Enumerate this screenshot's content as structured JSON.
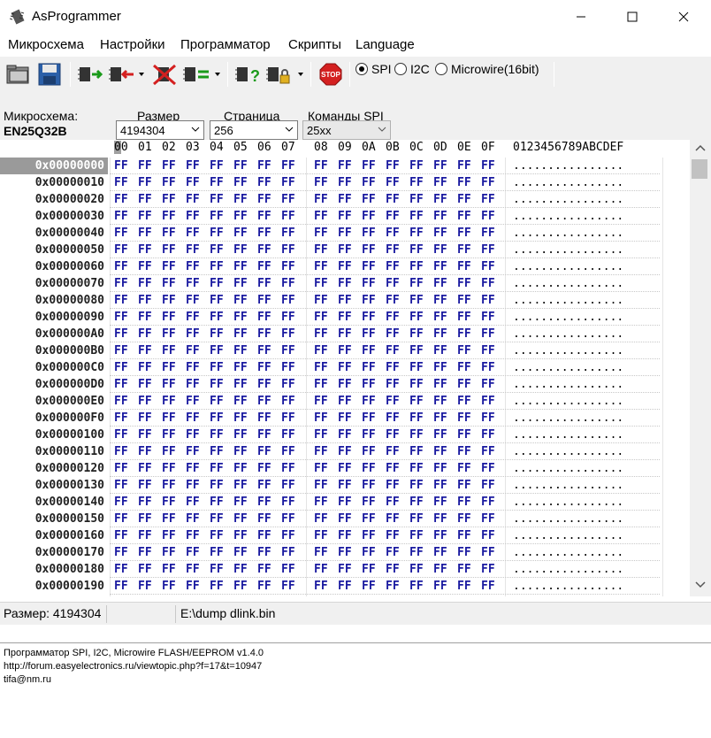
{
  "window": {
    "title": "AsProgrammer"
  },
  "menu": [
    "Микросхема",
    "Настройки",
    "Программатор",
    "Скрипты",
    "Language"
  ],
  "toolbar": {
    "stop_label": "STOP",
    "protocols": [
      {
        "label": "SPI",
        "selected": true
      },
      {
        "label": "I2C",
        "selected": false
      },
      {
        "label": "Microwire(16bit)",
        "selected": false
      }
    ]
  },
  "params": {
    "chip_label": "Микросхема:",
    "chip_name": "EN25Q32B",
    "size_label": "Размер",
    "size_value": "4194304",
    "page_label": "Страница",
    "page_value": "256",
    "commands_label": "Команды SPI",
    "commands_value": "25xx"
  },
  "hex": {
    "columns": [
      "00",
      "01",
      "02",
      "03",
      "04",
      "05",
      "06",
      "07",
      "08",
      "09",
      "0A",
      "0B",
      "0C",
      "0D",
      "0E",
      "0F"
    ],
    "ascii_header": "0123456789ABCDEF",
    "rows": [
      {
        "addr": "0x00000000",
        "bytes": [
          "FF",
          "FF",
          "FF",
          "FF",
          "FF",
          "FF",
          "FF",
          "FF",
          "FF",
          "FF",
          "FF",
          "FF",
          "FF",
          "FF",
          "FF",
          "FF"
        ],
        "ascii": "................"
      },
      {
        "addr": "0x00000010",
        "bytes": [
          "FF",
          "FF",
          "FF",
          "FF",
          "FF",
          "FF",
          "FF",
          "FF",
          "FF",
          "FF",
          "FF",
          "FF",
          "FF",
          "FF",
          "FF",
          "FF"
        ],
        "ascii": "................"
      },
      {
        "addr": "0x00000020",
        "bytes": [
          "FF",
          "FF",
          "FF",
          "FF",
          "FF",
          "FF",
          "FF",
          "FF",
          "FF",
          "FF",
          "FF",
          "FF",
          "FF",
          "FF",
          "FF",
          "FF"
        ],
        "ascii": "................"
      },
      {
        "addr": "0x00000030",
        "bytes": [
          "FF",
          "FF",
          "FF",
          "FF",
          "FF",
          "FF",
          "FF",
          "FF",
          "FF",
          "FF",
          "FF",
          "FF",
          "FF",
          "FF",
          "FF",
          "FF"
        ],
        "ascii": "................"
      },
      {
        "addr": "0x00000040",
        "bytes": [
          "FF",
          "FF",
          "FF",
          "FF",
          "FF",
          "FF",
          "FF",
          "FF",
          "FF",
          "FF",
          "FF",
          "FF",
          "FF",
          "FF",
          "FF",
          "FF"
        ],
        "ascii": "................"
      },
      {
        "addr": "0x00000050",
        "bytes": [
          "FF",
          "FF",
          "FF",
          "FF",
          "FF",
          "FF",
          "FF",
          "FF",
          "FF",
          "FF",
          "FF",
          "FF",
          "FF",
          "FF",
          "FF",
          "FF"
        ],
        "ascii": "................"
      },
      {
        "addr": "0x00000060",
        "bytes": [
          "FF",
          "FF",
          "FF",
          "FF",
          "FF",
          "FF",
          "FF",
          "FF",
          "FF",
          "FF",
          "FF",
          "FF",
          "FF",
          "FF",
          "FF",
          "FF"
        ],
        "ascii": "................"
      },
      {
        "addr": "0x00000070",
        "bytes": [
          "FF",
          "FF",
          "FF",
          "FF",
          "FF",
          "FF",
          "FF",
          "FF",
          "FF",
          "FF",
          "FF",
          "FF",
          "FF",
          "FF",
          "FF",
          "FF"
        ],
        "ascii": "................"
      },
      {
        "addr": "0x00000080",
        "bytes": [
          "FF",
          "FF",
          "FF",
          "FF",
          "FF",
          "FF",
          "FF",
          "FF",
          "FF",
          "FF",
          "FF",
          "FF",
          "FF",
          "FF",
          "FF",
          "FF"
        ],
        "ascii": "................"
      },
      {
        "addr": "0x00000090",
        "bytes": [
          "FF",
          "FF",
          "FF",
          "FF",
          "FF",
          "FF",
          "FF",
          "FF",
          "FF",
          "FF",
          "FF",
          "FF",
          "FF",
          "FF",
          "FF",
          "FF"
        ],
        "ascii": "................"
      },
      {
        "addr": "0x000000A0",
        "bytes": [
          "FF",
          "FF",
          "FF",
          "FF",
          "FF",
          "FF",
          "FF",
          "FF",
          "FF",
          "FF",
          "FF",
          "FF",
          "FF",
          "FF",
          "FF",
          "FF"
        ],
        "ascii": "................"
      },
      {
        "addr": "0x000000B0",
        "bytes": [
          "FF",
          "FF",
          "FF",
          "FF",
          "FF",
          "FF",
          "FF",
          "FF",
          "FF",
          "FF",
          "FF",
          "FF",
          "FF",
          "FF",
          "FF",
          "FF"
        ],
        "ascii": "................"
      },
      {
        "addr": "0x000000C0",
        "bytes": [
          "FF",
          "FF",
          "FF",
          "FF",
          "FF",
          "FF",
          "FF",
          "FF",
          "FF",
          "FF",
          "FF",
          "FF",
          "FF",
          "FF",
          "FF",
          "FF"
        ],
        "ascii": "................"
      },
      {
        "addr": "0x000000D0",
        "bytes": [
          "FF",
          "FF",
          "FF",
          "FF",
          "FF",
          "FF",
          "FF",
          "FF",
          "FF",
          "FF",
          "FF",
          "FF",
          "FF",
          "FF",
          "FF",
          "FF"
        ],
        "ascii": "................"
      },
      {
        "addr": "0x000000E0",
        "bytes": [
          "FF",
          "FF",
          "FF",
          "FF",
          "FF",
          "FF",
          "FF",
          "FF",
          "FF",
          "FF",
          "FF",
          "FF",
          "FF",
          "FF",
          "FF",
          "FF"
        ],
        "ascii": "................"
      },
      {
        "addr": "0x000000F0",
        "bytes": [
          "FF",
          "FF",
          "FF",
          "FF",
          "FF",
          "FF",
          "FF",
          "FF",
          "FF",
          "FF",
          "FF",
          "FF",
          "FF",
          "FF",
          "FF",
          "FF"
        ],
        "ascii": "................"
      },
      {
        "addr": "0x00000100",
        "bytes": [
          "FF",
          "FF",
          "FF",
          "FF",
          "FF",
          "FF",
          "FF",
          "FF",
          "FF",
          "FF",
          "FF",
          "FF",
          "FF",
          "FF",
          "FF",
          "FF"
        ],
        "ascii": "................"
      },
      {
        "addr": "0x00000110",
        "bytes": [
          "FF",
          "FF",
          "FF",
          "FF",
          "FF",
          "FF",
          "FF",
          "FF",
          "FF",
          "FF",
          "FF",
          "FF",
          "FF",
          "FF",
          "FF",
          "FF"
        ],
        "ascii": "................"
      },
      {
        "addr": "0x00000120",
        "bytes": [
          "FF",
          "FF",
          "FF",
          "FF",
          "FF",
          "FF",
          "FF",
          "FF",
          "FF",
          "FF",
          "FF",
          "FF",
          "FF",
          "FF",
          "FF",
          "FF"
        ],
        "ascii": "................"
      },
      {
        "addr": "0x00000130",
        "bytes": [
          "FF",
          "FF",
          "FF",
          "FF",
          "FF",
          "FF",
          "FF",
          "FF",
          "FF",
          "FF",
          "FF",
          "FF",
          "FF",
          "FF",
          "FF",
          "FF"
        ],
        "ascii": "................"
      },
      {
        "addr": "0x00000140",
        "bytes": [
          "FF",
          "FF",
          "FF",
          "FF",
          "FF",
          "FF",
          "FF",
          "FF",
          "FF",
          "FF",
          "FF",
          "FF",
          "FF",
          "FF",
          "FF",
          "FF"
        ],
        "ascii": "................"
      },
      {
        "addr": "0x00000150",
        "bytes": [
          "FF",
          "FF",
          "FF",
          "FF",
          "FF",
          "FF",
          "FF",
          "FF",
          "FF",
          "FF",
          "FF",
          "FF",
          "FF",
          "FF",
          "FF",
          "FF"
        ],
        "ascii": "................"
      },
      {
        "addr": "0x00000160",
        "bytes": [
          "FF",
          "FF",
          "FF",
          "FF",
          "FF",
          "FF",
          "FF",
          "FF",
          "FF",
          "FF",
          "FF",
          "FF",
          "FF",
          "FF",
          "FF",
          "FF"
        ],
        "ascii": "................"
      },
      {
        "addr": "0x00000170",
        "bytes": [
          "FF",
          "FF",
          "FF",
          "FF",
          "FF",
          "FF",
          "FF",
          "FF",
          "FF",
          "FF",
          "FF",
          "FF",
          "FF",
          "FF",
          "FF",
          "FF"
        ],
        "ascii": "................"
      },
      {
        "addr": "0x00000180",
        "bytes": [
          "FF",
          "FF",
          "FF",
          "FF",
          "FF",
          "FF",
          "FF",
          "FF",
          "FF",
          "FF",
          "FF",
          "FF",
          "FF",
          "FF",
          "FF",
          "FF"
        ],
        "ascii": "................"
      },
      {
        "addr": "0x00000190",
        "bytes": [
          "FF",
          "FF",
          "FF",
          "FF",
          "FF",
          "FF",
          "FF",
          "FF",
          "FF",
          "FF",
          "FF",
          "FF",
          "FF",
          "FF",
          "FF",
          "FF"
        ],
        "ascii": "................"
      }
    ]
  },
  "status": {
    "size": "Размер: 4194304",
    "file": "E:\\dump dlink.bin"
  },
  "log": [
    "Программатор SPI, I2C, Microwire FLASH/EEPROM v1.4.0",
    "http://forum.easyelectronics.ru/viewtopic.php?f=17&t=10947",
    "tifa@nm.ru"
  ],
  "colors": {
    "hex_byte": "#1a1aa0",
    "selected_address_bg": "#9a9a9a"
  }
}
